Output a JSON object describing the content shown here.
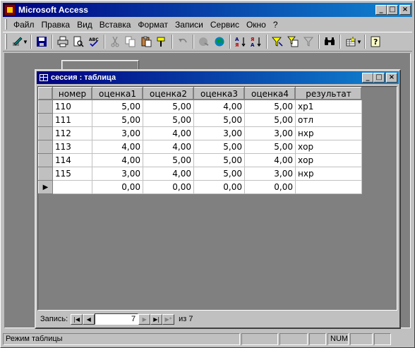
{
  "app": {
    "title": "Microsoft Access"
  },
  "window_buttons": {
    "minimize": "_",
    "maximize": "□",
    "close": "×"
  },
  "menu": [
    {
      "label": "Файл"
    },
    {
      "label": "Правка"
    },
    {
      "label": "Вид"
    },
    {
      "label": "Вставка"
    },
    {
      "label": "Формат"
    },
    {
      "label": "Записи"
    },
    {
      "label": "Сервис"
    },
    {
      "label": "Окно"
    },
    {
      "label": "?"
    }
  ],
  "toolbar": {
    "icons": [
      "design-view-icon",
      "save-icon",
      "print-icon",
      "print-preview-icon",
      "spelling-icon",
      "cut-icon",
      "copy-icon",
      "paste-icon",
      "format-painter-icon",
      "undo-icon",
      "insert-hyperlink-icon",
      "web-toolbar-icon",
      "sort-ascending-icon",
      "sort-descending-icon",
      "filter-by-selection-icon",
      "filter-by-form-icon",
      "apply-filter-icon",
      "find-icon",
      "new-record-icon",
      "help-icon"
    ]
  },
  "child_window": {
    "title": "сессия : таблица",
    "columns": [
      "номер",
      "оценка1",
      "оценка2",
      "оценка3",
      "оценка4",
      "результат"
    ],
    "rows": [
      [
        "110",
        "5,00",
        "5,00",
        "4,00",
        "5,00",
        "хр1"
      ],
      [
        "111",
        "5,00",
        "5,00",
        "5,00",
        "5,00",
        "отл"
      ],
      [
        "112",
        "3,00",
        "4,00",
        "3,00",
        "3,00",
        "нхр"
      ],
      [
        "113",
        "4,00",
        "4,00",
        "5,00",
        "5,00",
        "хор"
      ],
      [
        "114",
        "4,00",
        "5,00",
        "5,00",
        "4,00",
        "хор"
      ],
      [
        "115",
        "3,00",
        "4,00",
        "5,00",
        "3,00",
        "нхр"
      ]
    ],
    "new_row": [
      "",
      "0,00",
      "0,00",
      "0,00",
      "0,00",
      ""
    ],
    "record_nav": {
      "label": "Запись:",
      "current": "7",
      "of_text": "из 7"
    }
  },
  "status_bar": {
    "mode": "Режим таблицы",
    "num": "NUM"
  }
}
